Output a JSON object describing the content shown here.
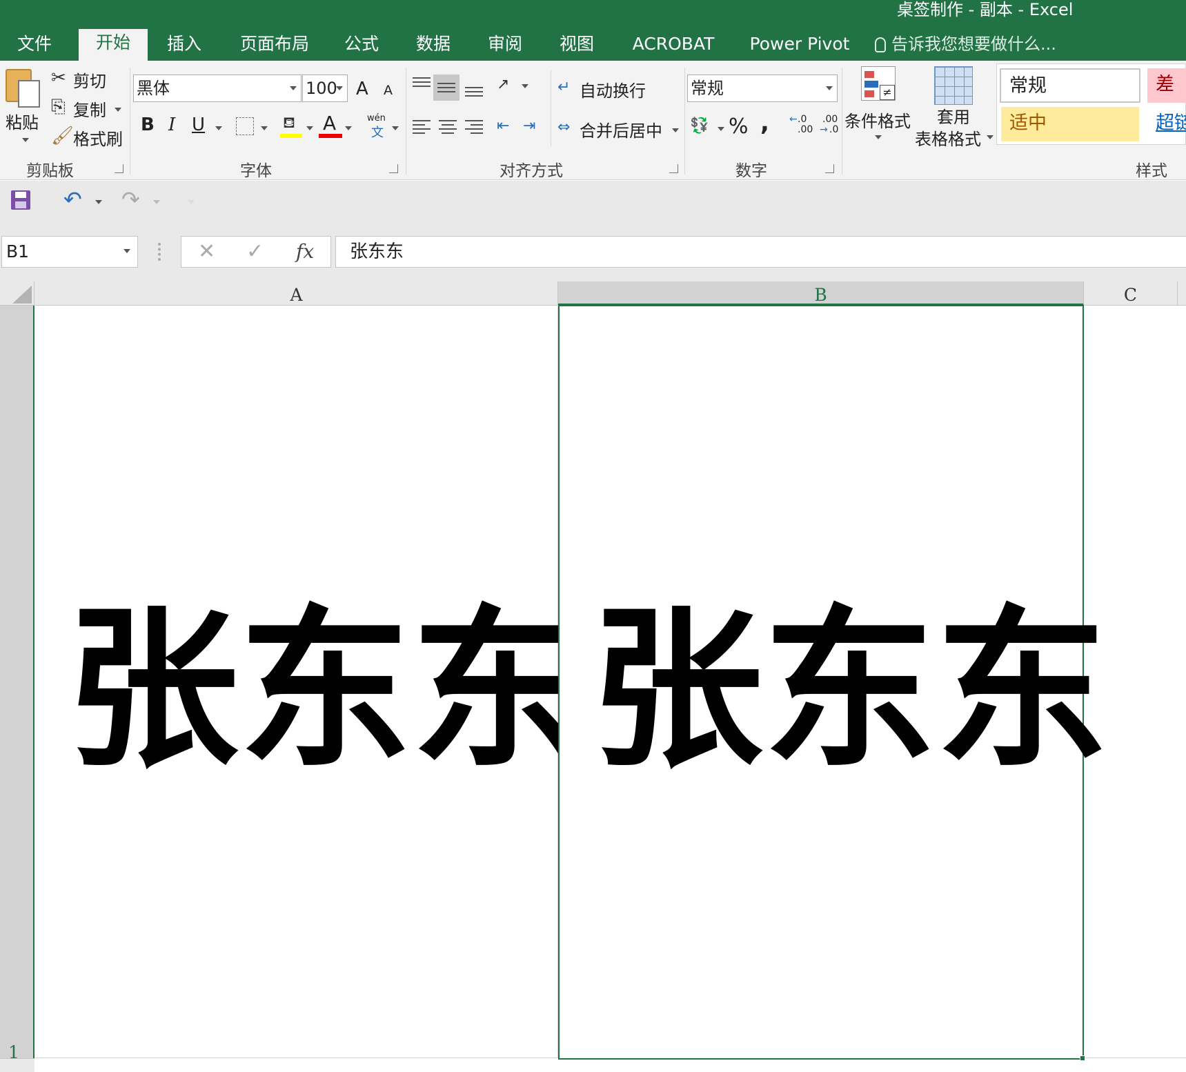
{
  "window": {
    "title": "桌签制作 - 副本 - Excel"
  },
  "tabs": [
    {
      "label": "文件"
    },
    {
      "label": "开始"
    },
    {
      "label": "插入"
    },
    {
      "label": "页面布局"
    },
    {
      "label": "公式"
    },
    {
      "label": "数据"
    },
    {
      "label": "审阅"
    },
    {
      "label": "视图"
    },
    {
      "label": "ACROBAT"
    },
    {
      "label": "Power Pivot"
    }
  ],
  "tell_me": "告诉我您想要做什么...",
  "ribbon": {
    "clipboard": {
      "paste": "粘贴",
      "cut": "剪切",
      "copy": "复制",
      "format_painter": "格式刷",
      "group": "剪贴板"
    },
    "font": {
      "name": "黑体",
      "size": "100",
      "group": "字体",
      "bold": "B",
      "italic": "I",
      "underline": "U",
      "grow": "A",
      "shrink": "A",
      "phonetic_top": "wén",
      "phonetic_bottom": "文"
    },
    "alignment": {
      "wrap": "自动换行",
      "merge": "合并后居中",
      "group": "对齐方式"
    },
    "number": {
      "format": "常规",
      "percent": "%",
      "comma": ",",
      "group": "数字",
      "inc_decimal_top": ".0",
      "inc_decimal_bottom": ".00",
      "dec_decimal_top": ".00",
      "dec_decimal_bottom": ".0"
    },
    "styles": {
      "conditional": "条件格式",
      "table_line1": "套用",
      "table_line2": "表格格式",
      "normal": "常规",
      "bad": "差",
      "neutral": "适中",
      "hyperlink": "超链",
      "group": "样式"
    }
  },
  "formula_bar": {
    "name_box": "B1",
    "fx": "fx",
    "content": "张东东"
  },
  "sheet": {
    "columns": [
      "A",
      "B",
      "C"
    ],
    "row": "1",
    "cell_a1": "张东东",
    "cell_b1": "张东东"
  },
  "colors": {
    "accent": "#217346",
    "bad_bg": "#ffc7ce",
    "bad_fg": "#9c0006",
    "neutral_bg": "#ffeb9c",
    "neutral_fg": "#9c5700",
    "hyperlink": "#0563c1"
  }
}
